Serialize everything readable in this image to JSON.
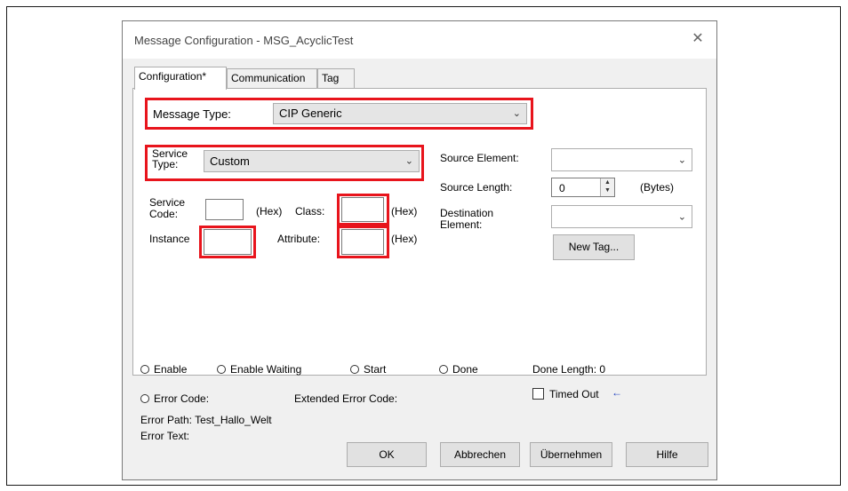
{
  "window": {
    "title": "Message Configuration - MSG_AcyclicTest",
    "close_glyph": "✕"
  },
  "tabs": [
    "Configuration*",
    "Communication",
    "Tag"
  ],
  "message_type": {
    "label": "Message Type:",
    "value": "CIP Generic"
  },
  "service_type": {
    "label_line1": "Service",
    "label_line2": "Type:",
    "value": "Custom"
  },
  "service_code": {
    "label_line1": "Service",
    "label_line2": "Code:",
    "unit": "(Hex)",
    "value": ""
  },
  "class": {
    "label": "Class:",
    "unit": "(Hex)",
    "value": ""
  },
  "instance": {
    "label": "Instance",
    "value": ""
  },
  "attribute": {
    "label": "Attribute:",
    "unit": "(Hex)",
    "value": ""
  },
  "source_element": {
    "label": "Source Element:",
    "value": ""
  },
  "source_length": {
    "label": "Source Length:",
    "value": "0",
    "unit": "(Bytes)"
  },
  "destination_element": {
    "label_line1": "Destination",
    "label_line2": "Element:",
    "value": ""
  },
  "new_tag_button": "New Tag...",
  "status": {
    "enable": "Enable",
    "enable_waiting": "Enable Waiting",
    "start": "Start",
    "done": "Done",
    "done_length": "Done Length: 0",
    "error_code": "Error Code:",
    "extended_error_code": "Extended Error Code:",
    "timed_out": "Timed Out",
    "timed_out_arrow": "←",
    "error_path": "Error Path: Test_Hallo_Welt",
    "error_text": "Error Text:"
  },
  "buttons": {
    "ok": "OK",
    "cancel": "Abbrechen",
    "apply": "Übernehmen",
    "help": "Hilfe"
  },
  "colors": {
    "highlight_red": "#e8141c",
    "arrow_blue": "#1f3fbf"
  },
  "icons": {
    "dropdown": "chevron-down-icon",
    "spinner": "spin-up-down-icon",
    "close": "close-icon"
  }
}
